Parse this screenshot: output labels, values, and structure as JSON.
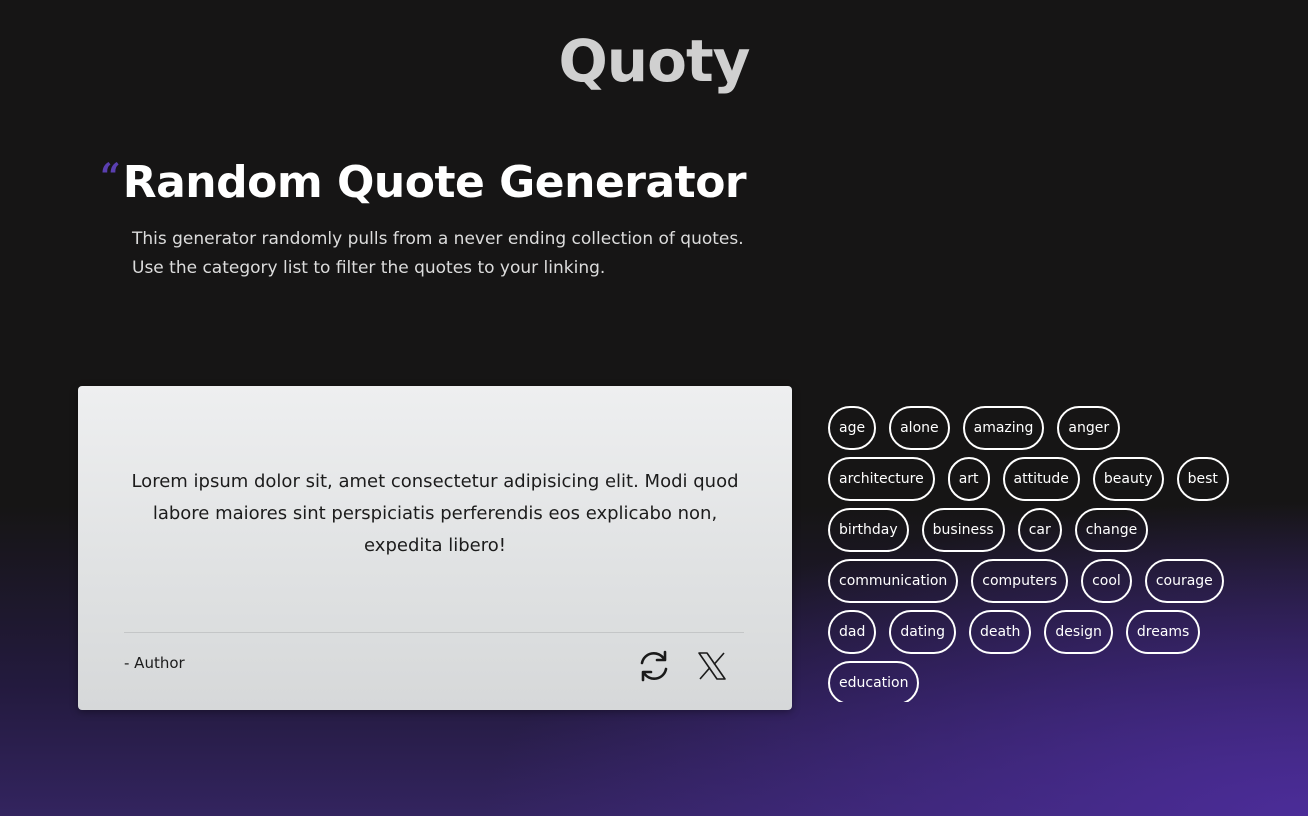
{
  "app": {
    "logo": "Quoty"
  },
  "hero": {
    "quote_mark": "“",
    "title": "Random Quote Generator",
    "description_line1": "This generator randomly pulls from a never ending collection of quotes.",
    "description_line2": "Use the category list to filter the quotes to your linking."
  },
  "quote_card": {
    "text": "Lorem ipsum dolor sit, amet consectetur adipisicing elit. Modi quod labore maiores sint perspiciatis perferendis eos explicabo non, expedita libero!",
    "author": "- Author",
    "refresh_icon": "refresh-icon",
    "share_icon": "x-twitter-icon"
  },
  "categories": [
    "age",
    "alone",
    "amazing",
    "anger",
    "architecture",
    "art",
    "attitude",
    "beauty",
    "best",
    "birthday",
    "business",
    "car",
    "change",
    "communication",
    "computers",
    "cool",
    "courage",
    "dad",
    "dating",
    "death",
    "design",
    "dreams",
    "education"
  ],
  "colors": {
    "background": "#161515",
    "accent": "#5a3fb0",
    "gradient_purple": "#4b2c98",
    "card": "#e4e6e7",
    "logo": "#d0d0d0"
  }
}
